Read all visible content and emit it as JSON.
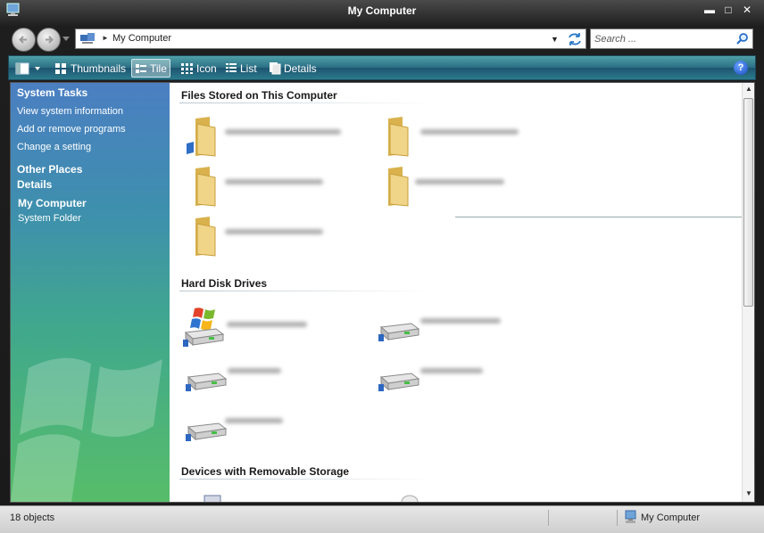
{
  "window": {
    "title": "My Computer",
    "minimize_glyph": "▬",
    "maximize_glyph": "□",
    "close_glyph": "✕"
  },
  "address": {
    "location": "My Computer",
    "dropdown_glyph": "▼",
    "chevron_glyph": "►",
    "search_placeholder": "Search ..."
  },
  "toolbar": {
    "thumbnails_label": "Thumbnails",
    "tile_label": "Tile",
    "icon_label": "Icon",
    "list_label": "List",
    "details_label": "Details",
    "help_label": "?",
    "active_view": "Tile"
  },
  "sidebar": {
    "system_tasks": "System Tasks",
    "view_info": "View system information",
    "add_remove": "Add or remove programs",
    "change_setting": "Change a setting",
    "other_places": "Other Places",
    "details": "Details",
    "selected_name": "My Computer",
    "selected_type": "System Folder"
  },
  "main": {
    "groups": [
      {
        "label": "Files Stored on This Computer",
        "item_icons": [
          "folder-icon",
          "folder-icon",
          "folder-icon",
          "folder-icon",
          "folder-icon"
        ]
      },
      {
        "label": "Hard Disk Drives",
        "item_icons": [
          "windows-drive-icon",
          "drive-icon",
          "drive-icon",
          "drive-icon",
          "drive-icon"
        ]
      },
      {
        "label": "Devices with Removable Storage",
        "item_icons": []
      }
    ]
  },
  "scrollbar": {
    "up_glyph": "▲",
    "down_glyph": "▼"
  },
  "status": {
    "count": "18 objects",
    "location": "My Computer"
  },
  "colors": {
    "sidebar_top": "#4b7fc2",
    "sidebar_bottom": "#57bd6a",
    "toolbar": "#2a6e84",
    "folder": "#e9c766"
  }
}
